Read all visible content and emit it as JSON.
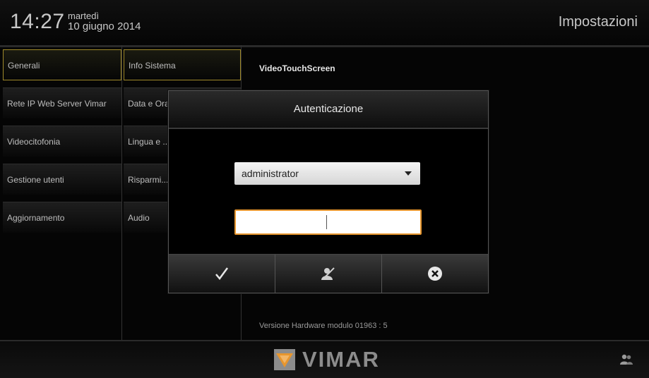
{
  "header": {
    "time": "14:27",
    "day": "martedì",
    "date": "10 giugno 2014",
    "section_title": "Impostazioni"
  },
  "menu_primary": [
    {
      "label": "Generali",
      "selected": true
    },
    {
      "label": "Rete IP Web Server Vimar",
      "selected": false
    },
    {
      "label": "Videocitofonia",
      "selected": false
    },
    {
      "label": "Gestione utenti",
      "selected": false
    },
    {
      "label": "Aggiornamento",
      "selected": false
    }
  ],
  "menu_secondary": [
    {
      "label": "Info Sistema",
      "selected": true
    },
    {
      "label": "Data e Ora",
      "selected": false
    },
    {
      "label": "Lingua e ...",
      "selected": false
    },
    {
      "label": "Risparmi...",
      "selected": false
    },
    {
      "label": "Audio",
      "selected": false
    }
  ],
  "content": {
    "device_name": "VideoTouchScreen",
    "hardware_version": "Versione Hardware modulo 01963 : 5"
  },
  "dialog": {
    "title": "Autenticazione",
    "user_select_value": "administrator",
    "password_value": "",
    "buttons": {
      "confirm_icon": "checkmark-icon",
      "edit_user_icon": "user-edit-icon",
      "cancel_icon": "close-circle-icon"
    }
  },
  "footer": {
    "brand": "VIMAR",
    "users_icon": "users-icon"
  },
  "colors": {
    "selected_border": "#a08a2a",
    "input_focus": "#e7962e",
    "logo_orange": "#e7962e",
    "logo_gray": "#8c8c8c"
  }
}
